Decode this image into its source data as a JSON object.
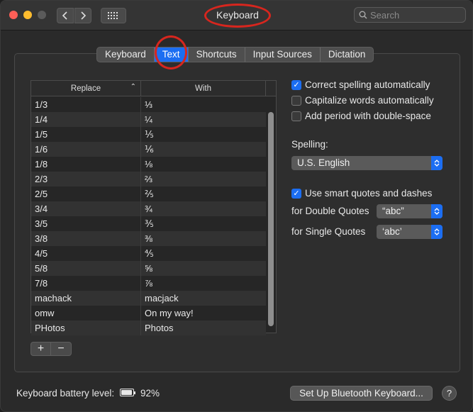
{
  "window": {
    "title": "Keyboard",
    "search_placeholder": "Search"
  },
  "tabs": [
    {
      "label": "Keyboard",
      "active": false
    },
    {
      "label": "Text",
      "active": true
    },
    {
      "label": "Shortcuts",
      "active": false
    },
    {
      "label": "Input Sources",
      "active": false
    },
    {
      "label": "Dictation",
      "active": false
    }
  ],
  "table": {
    "columns": [
      "Replace",
      "With"
    ],
    "rows": [
      {
        "replace": "1/3",
        "with": "⅓"
      },
      {
        "replace": "1/4",
        "with": "¼"
      },
      {
        "replace": "1/5",
        "with": "⅕"
      },
      {
        "replace": "1/6",
        "with": "⅙"
      },
      {
        "replace": "1/8",
        "with": "⅛"
      },
      {
        "replace": "2/3",
        "with": "⅔"
      },
      {
        "replace": "2/5",
        "with": "⅖"
      },
      {
        "replace": "3/4",
        "with": "¾"
      },
      {
        "replace": "3/5",
        "with": "⅗"
      },
      {
        "replace": "3/8",
        "with": "⅜"
      },
      {
        "replace": "4/5",
        "with": "⅘"
      },
      {
        "replace": "5/8",
        "with": "⅝"
      },
      {
        "replace": "7/8",
        "with": "⅞"
      },
      {
        "replace": "machack",
        "with": "macjack"
      },
      {
        "replace": "omw",
        "with": "On my way!"
      },
      {
        "replace": "PHotos",
        "with": "Photos"
      }
    ],
    "add_label": "+",
    "remove_label": "−"
  },
  "options": {
    "correct_spelling": {
      "label": "Correct spelling automatically",
      "checked": true
    },
    "capitalize_words": {
      "label": "Capitalize words automatically",
      "checked": false
    },
    "add_period": {
      "label": "Add period with double-space",
      "checked": false
    },
    "spelling_label": "Spelling:",
    "spelling_value": "U.S. English",
    "smart_quotes": {
      "label": "Use smart quotes and dashes",
      "checked": true
    },
    "double_quotes_label": "for Double Quotes",
    "double_quotes_value": "“abc”",
    "single_quotes_label": "for Single Quotes",
    "single_quotes_value": "‘abc’"
  },
  "footer": {
    "battery_label": "Keyboard battery level:",
    "battery_percent": "92%",
    "battery_level": 0.92,
    "bluetooth_button": "Set Up Bluetooth Keyboard...",
    "help_label": "?"
  },
  "colors": {
    "accent": "#1c6ef2",
    "annotation": "#d7261e"
  }
}
